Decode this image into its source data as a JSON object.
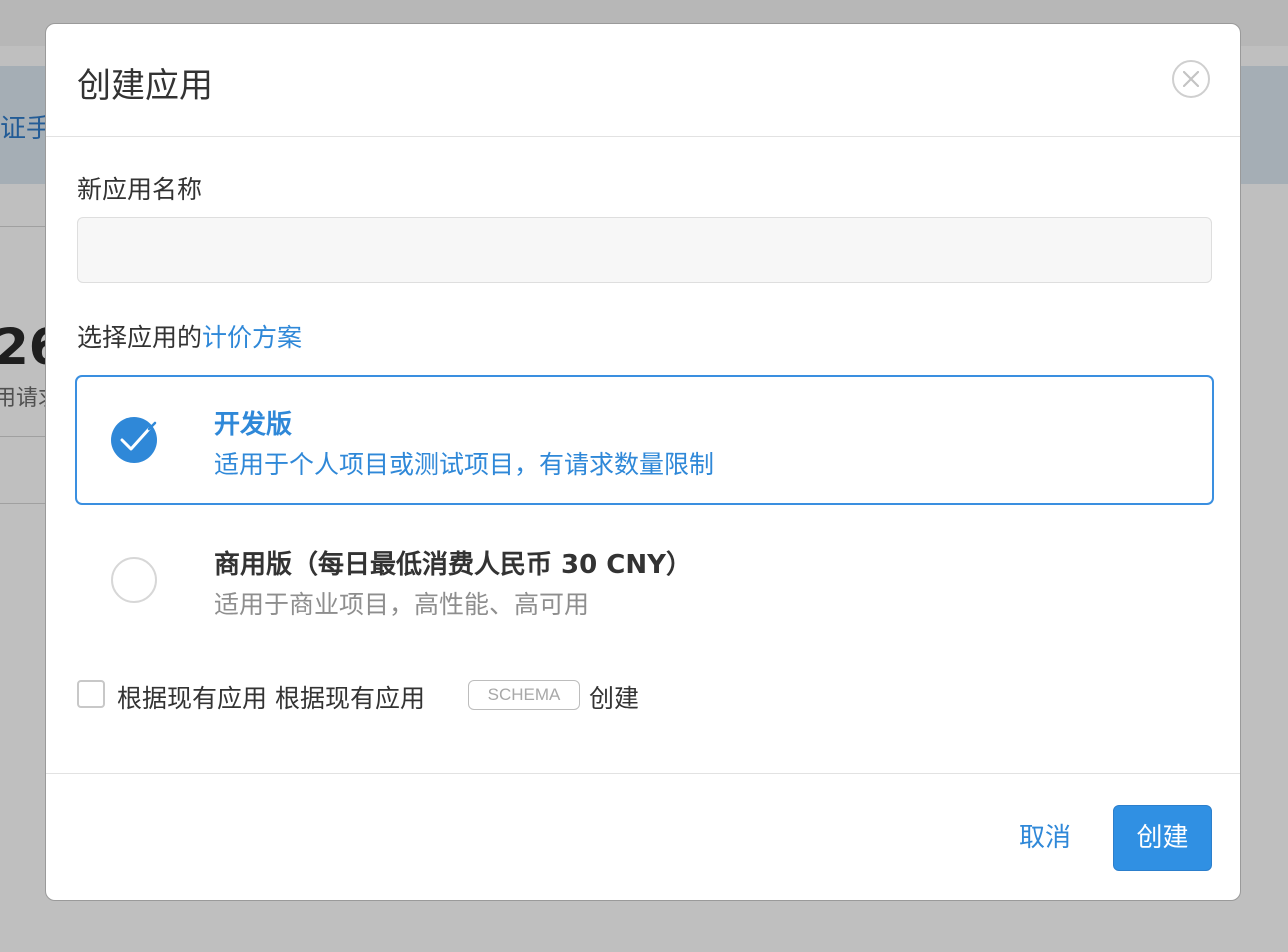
{
  "background": {
    "banner_text": "证手",
    "stat_number": "26",
    "stat_label": "用请求"
  },
  "modal": {
    "title": "创建应用",
    "close_icon": "close-icon",
    "name_field": {
      "label": "新应用名称",
      "value": "",
      "placeholder": ""
    },
    "plan_section": {
      "label_prefix": "选择应用的",
      "label_link": "计价方案"
    },
    "plans": [
      {
        "name": "开发版",
        "description": "适用于个人项目或测试项目，有请求数量限制",
        "selected": true
      },
      {
        "name": "商用版（每日最低消费人民币 30 CNY）",
        "description": "适用于商业项目，高性能、高可用",
        "selected": false
      }
    ],
    "schema_option": {
      "checked": false,
      "text_before": "根据现有应用 根据现有应用",
      "tag": "SCHEMA",
      "text_after": "创建"
    },
    "footer": {
      "cancel_label": "取消",
      "create_label": "创建"
    }
  },
  "colors": {
    "accent": "#2f88d8",
    "primary_button": "#3090e3",
    "text": "#333333",
    "muted_text": "#8e8e8e"
  }
}
